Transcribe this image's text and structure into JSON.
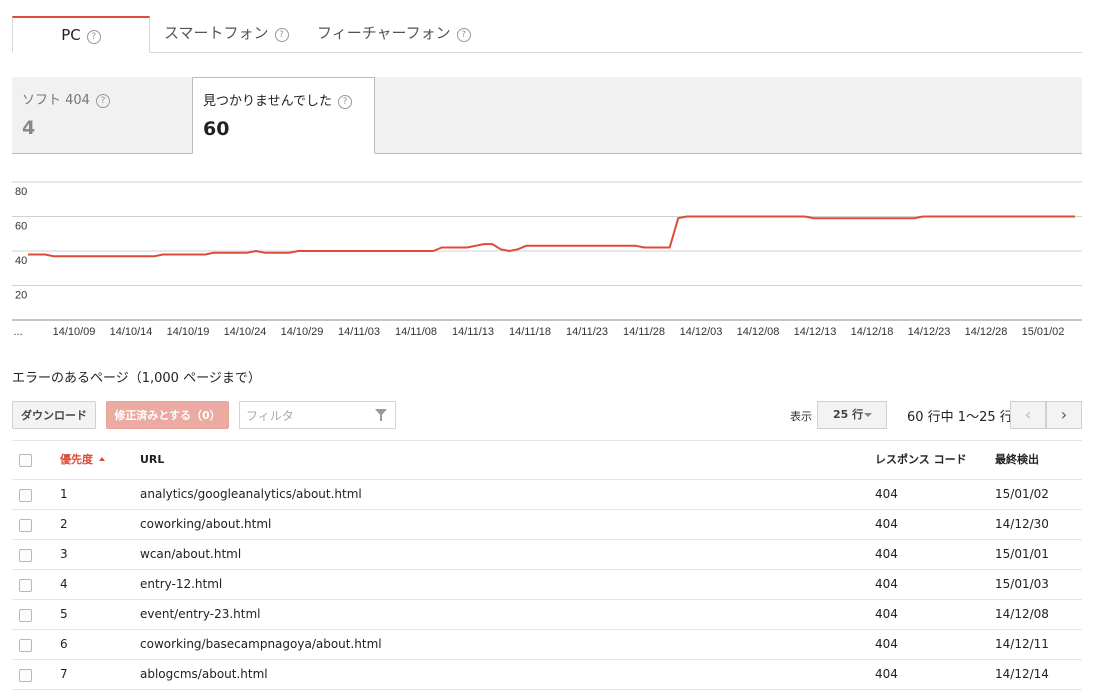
{
  "device_tabs": [
    {
      "label": "PC",
      "active": true
    },
    {
      "label": "スマートフォン",
      "active": false
    },
    {
      "label": "フィーチャーフォン",
      "active": false
    }
  ],
  "help_glyph": "?",
  "error_types": [
    {
      "label": "ソフト 404",
      "count": "4",
      "active": false
    },
    {
      "label": "見つかりませんでした",
      "count": "60",
      "active": true
    }
  ],
  "chart_data": {
    "type": "line",
    "x_labels": [
      "...",
      "14/10/09",
      "14/10/14",
      "14/10/19",
      "14/10/24",
      "14/10/29",
      "14/11/03",
      "14/11/08",
      "14/11/13",
      "14/11/18",
      "14/11/23",
      "14/11/28",
      "14/12/03",
      "14/12/08",
      "14/12/13",
      "14/12/18",
      "14/12/23",
      "14/12/28",
      "15/01/02"
    ],
    "y_ticks": [
      80,
      60,
      40,
      20
    ],
    "ylim": [
      0,
      80
    ],
    "series": [
      {
        "color": "#dd4b39",
        "values": [
          38,
          38,
          38,
          37,
          37,
          37,
          37,
          37,
          37,
          37,
          37,
          37,
          37,
          37,
          37,
          37,
          38,
          38,
          38,
          38,
          38,
          38,
          39,
          39,
          39,
          39,
          39,
          40,
          39,
          39,
          39,
          39,
          40,
          40,
          40,
          40,
          40,
          40,
          40,
          40,
          40,
          40,
          40,
          40,
          40,
          40,
          40,
          40,
          40,
          42,
          42,
          42,
          42,
          43,
          44,
          44,
          41,
          40,
          41,
          43,
          43,
          43,
          43,
          43,
          43,
          43,
          43,
          43,
          43,
          43,
          43,
          43,
          43,
          42,
          42,
          42,
          42,
          59,
          60,
          60,
          60,
          60,
          60,
          60,
          60,
          60,
          60,
          60,
          60,
          60,
          60,
          60,
          60,
          59,
          59,
          59,
          59,
          59,
          59,
          59,
          59,
          59,
          59,
          59,
          59,
          59,
          60,
          60,
          60,
          60,
          60,
          60,
          60,
          60,
          60,
          60,
          60,
          60,
          60,
          60,
          60,
          60,
          60,
          60,
          60
        ]
      }
    ]
  },
  "section_title": "エラーのあるページ（1,000 ページまで）",
  "toolbar": {
    "download": "ダウンロード",
    "mark_fixed": "修正済みとする（0）",
    "filter_placeholder": "フィルタ",
    "show_label": "表示",
    "rows_per_page": "25 行",
    "range_text": "60 行中 1〜25 行",
    "prev_glyph": "‹",
    "next_glyph": "›"
  },
  "table": {
    "headers": {
      "priority": "優先度",
      "url": "URL",
      "response_code": "レスポンス コード",
      "last_detected": "最終検出"
    },
    "rows": [
      {
        "priority": "1",
        "url": "analytics/googleanalytics/about.html",
        "code": "404",
        "date": "15/01/02"
      },
      {
        "priority": "2",
        "url": "coworking/about.html",
        "code": "404",
        "date": "14/12/30"
      },
      {
        "priority": "3",
        "url": "wcan/about.html",
        "code": "404",
        "date": "15/01/01"
      },
      {
        "priority": "4",
        "url": "entry-12.html",
        "code": "404",
        "date": "15/01/03"
      },
      {
        "priority": "5",
        "url": "event/entry-23.html",
        "code": "404",
        "date": "14/12/08"
      },
      {
        "priority": "6",
        "url": "coworking/basecampnagoya/about.html",
        "code": "404",
        "date": "14/12/11"
      },
      {
        "priority": "7",
        "url": "ablogcms/about.html",
        "code": "404",
        "date": "14/12/14"
      }
    ]
  }
}
